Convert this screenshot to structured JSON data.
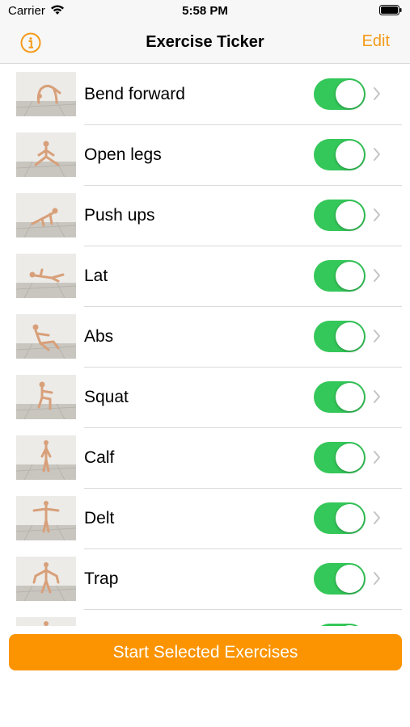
{
  "status_bar": {
    "carrier": "Carrier",
    "time": "5:58 PM"
  },
  "nav": {
    "title": "Exercise Ticker",
    "edit_label": "Edit",
    "info_icon": "info-circle-icon"
  },
  "colors": {
    "accent": "#f49b1a",
    "toggle_on": "#34c759",
    "button": "#fb9400"
  },
  "exercises": [
    {
      "name": "Bend forward",
      "enabled": true
    },
    {
      "name": "Open legs",
      "enabled": true
    },
    {
      "name": "Push ups",
      "enabled": true
    },
    {
      "name": "Lat",
      "enabled": true
    },
    {
      "name": "Abs",
      "enabled": true
    },
    {
      "name": "Squat",
      "enabled": true
    },
    {
      "name": "Calf",
      "enabled": true
    },
    {
      "name": "Delt",
      "enabled": true
    },
    {
      "name": "Trap",
      "enabled": true
    },
    {
      "name": "",
      "enabled": true
    }
  ],
  "start_button": {
    "label": "Start Selected Exercises"
  }
}
